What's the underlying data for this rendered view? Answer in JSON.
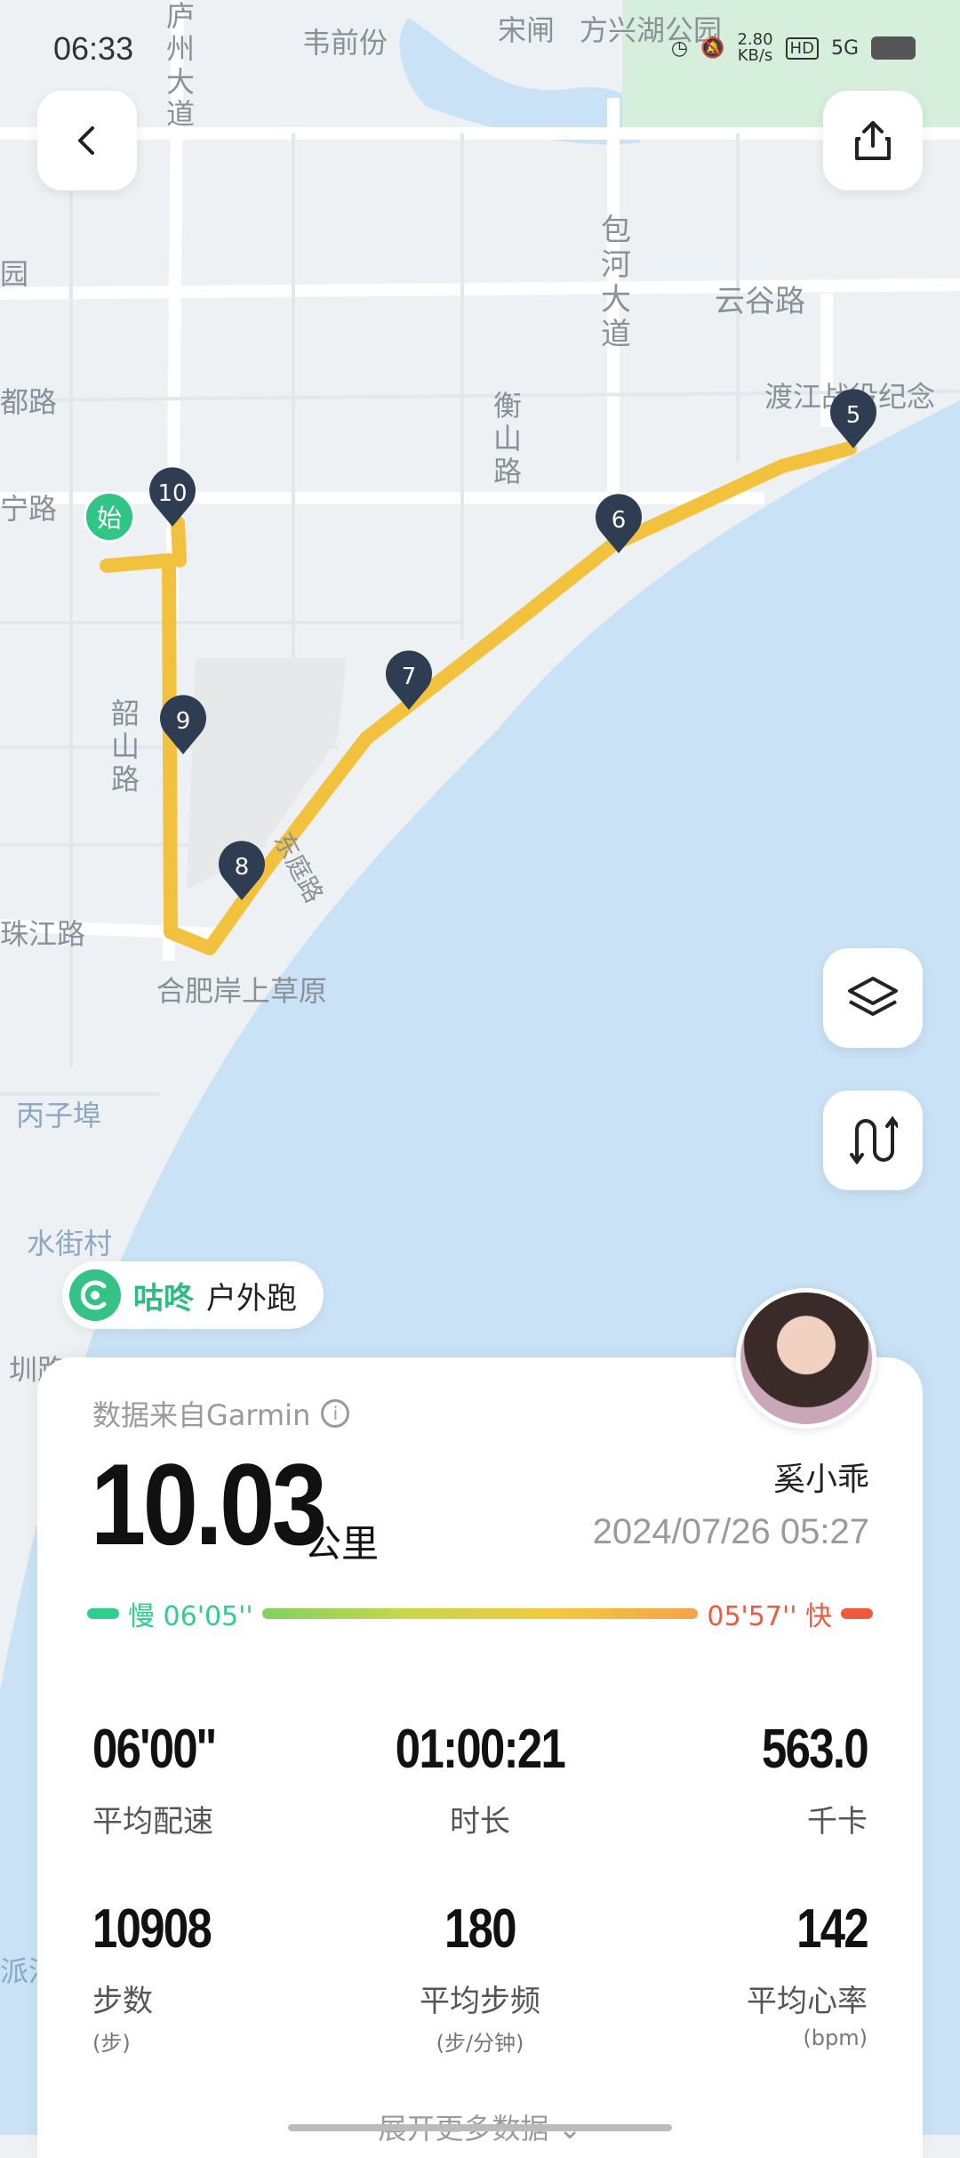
{
  "status_bar": {
    "time": "06:33",
    "net_speed": "2.80",
    "net_unit": "KB/s",
    "hd": "HD",
    "signal": "5G"
  },
  "map": {
    "labels": {
      "weiqianfen": "韦前份",
      "songzha": "宋闸",
      "fangxinghu": "方兴湖公园",
      "luzhou_dadao": "庐州大道",
      "baohe_dadao": "包河大道",
      "yungu_lu": "云谷路",
      "dujiang": "渡江战役纪念",
      "hengshan_lu": "衡山路",
      "shaoshan_lu": "韶山路",
      "du_lu": "都路",
      "ning_lu": "宁路",
      "zhujiang_lu": "珠江路",
      "dongting_lu": "东庭路",
      "caoyuan": "合肥岸上草原",
      "bingzibu": "丙子埠",
      "shuijiecun": "水街村",
      "zhen_lu": "圳路",
      "yuan": "园",
      "pai": "派河"
    },
    "start_marker": "始",
    "km_markers": [
      "5",
      "6",
      "7",
      "8",
      "9",
      "10"
    ]
  },
  "brand": {
    "name": "咕咚",
    "activity": "户外跑"
  },
  "summary": {
    "source": "数据来自Garmin",
    "info_glyph": "i",
    "distance": "10.03",
    "unit": "公里",
    "user": "奚小乖",
    "datetime": "2024/07/26 05:27",
    "pace_slow": "慢 06'05''",
    "pace_fast": "05'57'' 快",
    "colors": {
      "slow": "#2ecf8c",
      "fast": "#f05a3c",
      "route": "#f2c23e",
      "brand": "#2dbb7e"
    }
  },
  "stats": [
    {
      "value": "06'00''",
      "label": "平均配速",
      "sub": ""
    },
    {
      "value": "01:00:21",
      "label": "时长",
      "sub": ""
    },
    {
      "value": "563.0",
      "label": "千卡",
      "sub": ""
    },
    {
      "value": "10908",
      "label": "步数",
      "sub": "(步)"
    },
    {
      "value": "180",
      "label": "平均步频",
      "sub": "(步/分钟)"
    },
    {
      "value": "142",
      "label": "平均心率",
      "sub": "(bpm)"
    }
  ],
  "expand_label": "展开更多数据",
  "icons": {
    "back": "chevron-left-icon",
    "share": "share-icon",
    "layers": "layers-icon",
    "route": "route-toggle-icon"
  }
}
